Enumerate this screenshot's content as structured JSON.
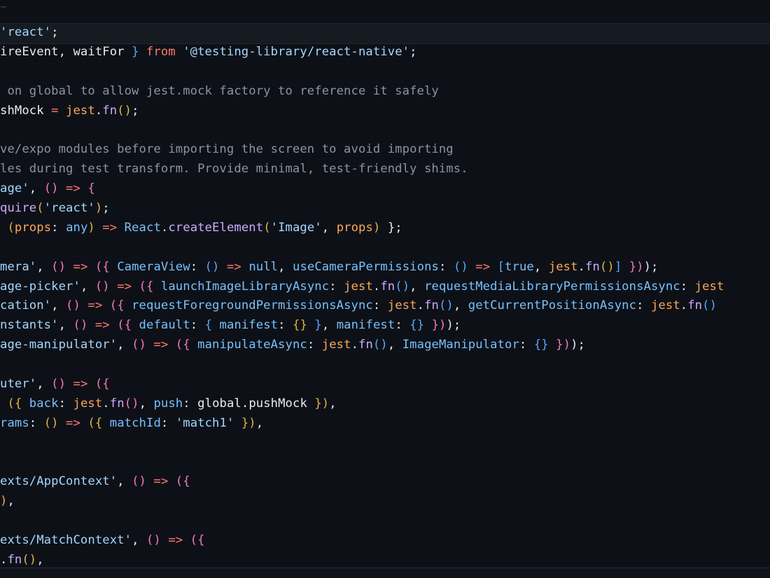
{
  "editor": {
    "top_mark": "~",
    "lines": [
      [
        {
          "t": "'react'",
          "c": "str"
        },
        {
          "t": ";",
          "c": "plain"
        }
      ],
      [
        {
          "t": "ireEvent, waitFor ",
          "c": "plain"
        },
        {
          "t": "}",
          "c": "br3"
        },
        {
          "t": " from ",
          "c": "kw"
        },
        {
          "t": "'@testing-library/react-native'",
          "c": "str"
        },
        {
          "t": ";",
          "c": "plain"
        }
      ],
      [],
      [
        {
          "t": " on global to allow jest.mock factory to reference it safely",
          "c": "cmnt"
        }
      ],
      [
        {
          "t": "shMock ",
          "c": "plain"
        },
        {
          "t": "=",
          "c": "op"
        },
        {
          "t": " jest",
          "c": "obj"
        },
        {
          "t": ".",
          "c": "plain"
        },
        {
          "t": "fn",
          "c": "call"
        },
        {
          "t": "()",
          "c": "br1"
        },
        {
          "t": ";",
          "c": "plain"
        }
      ],
      [],
      [
        {
          "t": "ve/expo modules before importing the screen to avoid importing",
          "c": "cmnt"
        }
      ],
      [
        {
          "t": "les during test transform. Provide minimal, test-friendly shims.",
          "c": "cmnt"
        }
      ],
      [
        {
          "t": "age'",
          "c": "str"
        },
        {
          "t": ", ",
          "c": "plain"
        },
        {
          "t": "()",
          "c": "br2"
        },
        {
          "t": " => ",
          "c": "op"
        },
        {
          "t": "{",
          "c": "br2"
        }
      ],
      [
        {
          "t": "quire",
          "c": "call"
        },
        {
          "t": "(",
          "c": "br1"
        },
        {
          "t": "'react'",
          "c": "str"
        },
        {
          "t": ")",
          "c": "br1"
        },
        {
          "t": ";",
          "c": "plain"
        }
      ],
      [
        {
          "t": " (",
          "c": "br1"
        },
        {
          "t": "props",
          "c": "obj"
        },
        {
          "t": ": ",
          "c": "plain"
        },
        {
          "t": "any",
          "c": "type"
        },
        {
          "t": ")",
          "c": "br1"
        },
        {
          "t": " => ",
          "c": "op"
        },
        {
          "t": "React",
          "c": "prop"
        },
        {
          "t": ".",
          "c": "plain"
        },
        {
          "t": "createElement",
          "c": "call"
        },
        {
          "t": "(",
          "c": "br1"
        },
        {
          "t": "'Image'",
          "c": "str"
        },
        {
          "t": ", ",
          "c": "plain"
        },
        {
          "t": "props",
          "c": "obj"
        },
        {
          "t": ")",
          "c": "br1"
        },
        {
          "t": " };",
          "c": "plain"
        }
      ],
      [],
      [
        {
          "t": "mera'",
          "c": "str"
        },
        {
          "t": ", ",
          "c": "plain"
        },
        {
          "t": "()",
          "c": "br2"
        },
        {
          "t": " => ",
          "c": "op"
        },
        {
          "t": "({",
          "c": "br2"
        },
        {
          "t": " CameraView",
          "c": "prop"
        },
        {
          "t": ": ",
          "c": "plain"
        },
        {
          "t": "()",
          "c": "br3"
        },
        {
          "t": " => ",
          "c": "op"
        },
        {
          "t": "null",
          "c": "num"
        },
        {
          "t": ", ",
          "c": "plain"
        },
        {
          "t": "useCameraPermissions",
          "c": "prop"
        },
        {
          "t": ": ",
          "c": "plain"
        },
        {
          "t": "()",
          "c": "br3"
        },
        {
          "t": " => ",
          "c": "op"
        },
        {
          "t": "[",
          "c": "br3"
        },
        {
          "t": "true",
          "c": "num"
        },
        {
          "t": ", ",
          "c": "plain"
        },
        {
          "t": "jest",
          "c": "obj"
        },
        {
          "t": ".",
          "c": "plain"
        },
        {
          "t": "fn",
          "c": "call"
        },
        {
          "t": "()",
          "c": "br1"
        },
        {
          "t": "]",
          "c": "br3"
        },
        {
          "t": " })",
          "c": "br2"
        },
        {
          "t": ");",
          "c": "plain"
        }
      ],
      [
        {
          "t": "age-picker'",
          "c": "str"
        },
        {
          "t": ", ",
          "c": "plain"
        },
        {
          "t": "()",
          "c": "br2"
        },
        {
          "t": " => ",
          "c": "op"
        },
        {
          "t": "({",
          "c": "br2"
        },
        {
          "t": " launchImageLibraryAsync",
          "c": "prop"
        },
        {
          "t": ": ",
          "c": "plain"
        },
        {
          "t": "jest",
          "c": "obj"
        },
        {
          "t": ".",
          "c": "plain"
        },
        {
          "t": "fn",
          "c": "call"
        },
        {
          "t": "()",
          "c": "br3"
        },
        {
          "t": ", ",
          "c": "plain"
        },
        {
          "t": "requestMediaLibraryPermissionsAsync",
          "c": "prop"
        },
        {
          "t": ": ",
          "c": "plain"
        },
        {
          "t": "jest",
          "c": "obj"
        }
      ],
      [
        {
          "t": "cation'",
          "c": "str"
        },
        {
          "t": ", ",
          "c": "plain"
        },
        {
          "t": "()",
          "c": "br2"
        },
        {
          "t": " => ",
          "c": "op"
        },
        {
          "t": "({",
          "c": "br2"
        },
        {
          "t": " requestForegroundPermissionsAsync",
          "c": "prop"
        },
        {
          "t": ": ",
          "c": "plain"
        },
        {
          "t": "jest",
          "c": "obj"
        },
        {
          "t": ".",
          "c": "plain"
        },
        {
          "t": "fn",
          "c": "call"
        },
        {
          "t": "()",
          "c": "br3"
        },
        {
          "t": ", ",
          "c": "plain"
        },
        {
          "t": "getCurrentPositionAsync",
          "c": "prop"
        },
        {
          "t": ": ",
          "c": "plain"
        },
        {
          "t": "jest",
          "c": "obj"
        },
        {
          "t": ".",
          "c": "plain"
        },
        {
          "t": "fn",
          "c": "call"
        },
        {
          "t": "()",
          "c": "br3"
        }
      ],
      [
        {
          "t": "nstants'",
          "c": "str"
        },
        {
          "t": ", ",
          "c": "plain"
        },
        {
          "t": "()",
          "c": "br2"
        },
        {
          "t": " => ",
          "c": "op"
        },
        {
          "t": "({",
          "c": "br2"
        },
        {
          "t": " default",
          "c": "prop"
        },
        {
          "t": ": ",
          "c": "plain"
        },
        {
          "t": "{",
          "c": "br3"
        },
        {
          "t": " manifest",
          "c": "prop"
        },
        {
          "t": ": ",
          "c": "plain"
        },
        {
          "t": "{}",
          "c": "br1"
        },
        {
          "t": " }",
          "c": "br3"
        },
        {
          "t": ", ",
          "c": "plain"
        },
        {
          "t": "manifest",
          "c": "prop"
        },
        {
          "t": ": ",
          "c": "plain"
        },
        {
          "t": "{}",
          "c": "br3"
        },
        {
          "t": " })",
          "c": "br2"
        },
        {
          "t": ");",
          "c": "plain"
        }
      ],
      [
        {
          "t": "age-manipulator'",
          "c": "str"
        },
        {
          "t": ", ",
          "c": "plain"
        },
        {
          "t": "()",
          "c": "br2"
        },
        {
          "t": " => ",
          "c": "op"
        },
        {
          "t": "({",
          "c": "br2"
        },
        {
          "t": " manipulateAsync",
          "c": "prop"
        },
        {
          "t": ": ",
          "c": "plain"
        },
        {
          "t": "jest",
          "c": "obj"
        },
        {
          "t": ".",
          "c": "plain"
        },
        {
          "t": "fn",
          "c": "call"
        },
        {
          "t": "()",
          "c": "br3"
        },
        {
          "t": ", ",
          "c": "plain"
        },
        {
          "t": "ImageManipulator",
          "c": "prop"
        },
        {
          "t": ": ",
          "c": "plain"
        },
        {
          "t": "{}",
          "c": "br3"
        },
        {
          "t": " })",
          "c": "br2"
        },
        {
          "t": ");",
          "c": "plain"
        }
      ],
      [],
      [
        {
          "t": "uter'",
          "c": "str"
        },
        {
          "t": ", ",
          "c": "plain"
        },
        {
          "t": "()",
          "c": "br2"
        },
        {
          "t": " => ",
          "c": "op"
        },
        {
          "t": "({",
          "c": "br2"
        }
      ],
      [
        {
          "t": " ({",
          "c": "br1"
        },
        {
          "t": " back",
          "c": "prop"
        },
        {
          "t": ": ",
          "c": "plain"
        },
        {
          "t": "jest",
          "c": "obj"
        },
        {
          "t": ".",
          "c": "plain"
        },
        {
          "t": "fn",
          "c": "call"
        },
        {
          "t": "()",
          "c": "br2"
        },
        {
          "t": ", ",
          "c": "plain"
        },
        {
          "t": "push",
          "c": "prop"
        },
        {
          "t": ": ",
          "c": "plain"
        },
        {
          "t": "global",
          "c": "plain"
        },
        {
          "t": ".",
          "c": "plain"
        },
        {
          "t": "pushMock",
          "c": "plain"
        },
        {
          "t": " })",
          "c": "br1"
        },
        {
          "t": ",",
          "c": "plain"
        }
      ],
      [
        {
          "t": "rams",
          "c": "prop"
        },
        {
          "t": ": ",
          "c": "plain"
        },
        {
          "t": "()",
          "c": "br1"
        },
        {
          "t": " => ",
          "c": "op"
        },
        {
          "t": "({",
          "c": "br1"
        },
        {
          "t": " matchId",
          "c": "prop"
        },
        {
          "t": ": ",
          "c": "plain"
        },
        {
          "t": "'match1'",
          "c": "str"
        },
        {
          "t": " })",
          "c": "br1"
        },
        {
          "t": ",",
          "c": "plain"
        }
      ],
      [],
      [],
      [
        {
          "t": "exts/AppContext'",
          "c": "str"
        },
        {
          "t": ", ",
          "c": "plain"
        },
        {
          "t": "()",
          "c": "br2"
        },
        {
          "t": " => ",
          "c": "op"
        },
        {
          "t": "({",
          "c": "br2"
        }
      ],
      [
        {
          "t": ")",
          "c": "br1"
        },
        {
          "t": ",",
          "c": "plain"
        }
      ],
      [],
      [
        {
          "t": "exts/MatchContext'",
          "c": "str"
        },
        {
          "t": ", ",
          "c": "plain"
        },
        {
          "t": "()",
          "c": "br2"
        },
        {
          "t": " => ",
          "c": "op"
        },
        {
          "t": "({",
          "c": "br2"
        }
      ],
      [
        {
          "t": ".",
          "c": "plain"
        },
        {
          "t": "fn",
          "c": "call"
        },
        {
          "t": "()",
          "c": "br1"
        },
        {
          "t": ",",
          "c": "plain"
        }
      ]
    ]
  }
}
